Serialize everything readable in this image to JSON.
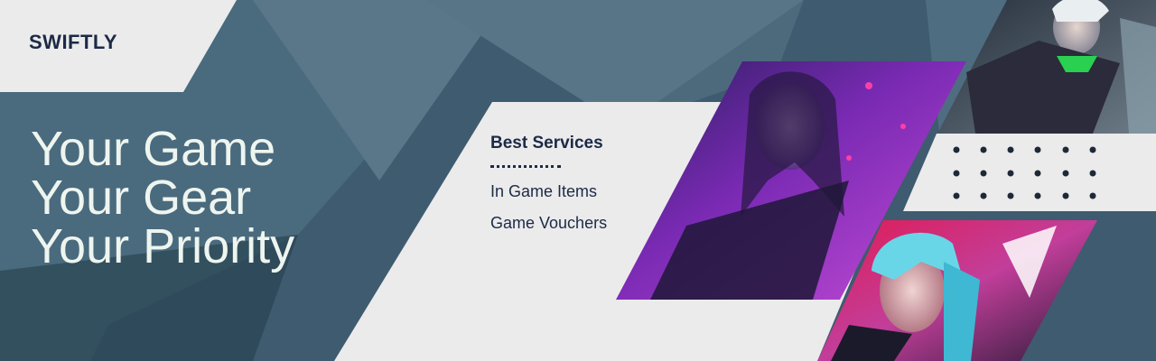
{
  "brand": {
    "name": "SWIFTLY"
  },
  "headline": {
    "lines": [
      "Your Game",
      "Your Gear",
      "Your Priority"
    ]
  },
  "services": {
    "title": "Best Services",
    "items": [
      "In Game Items",
      "Game Vouchers"
    ]
  },
  "colors": {
    "background": "#3f5b6f",
    "panel": "#ebebec",
    "text_dark": "#1c2a45",
    "headline_text": "#eef5ef"
  },
  "images": [
    {
      "name": "purple-haired-warrior-artwork"
    },
    {
      "name": "armored-knight-artwork"
    },
    {
      "name": "cyan-haired-heroine-artwork"
    }
  ]
}
